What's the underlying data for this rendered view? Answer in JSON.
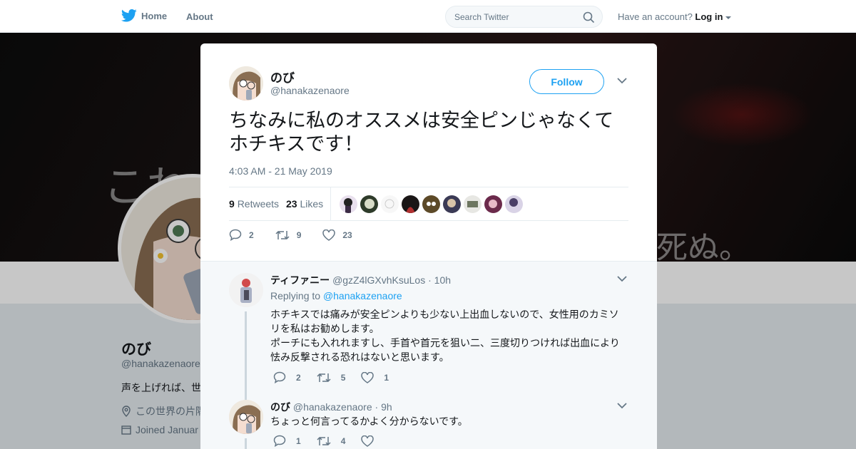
{
  "nav": {
    "home_label": "Home",
    "about_label": "About",
    "search_placeholder": "Search Twitter",
    "account_prompt": "Have an account?",
    "login_label": "Log in"
  },
  "background_profile": {
    "banner_glyphs": [
      "これ",
      "死ぬ。"
    ],
    "name": "のび",
    "handle": "@hanakazenaore",
    "bio": "声を上げれば、世",
    "location": "この世界の片隅",
    "joined": "Joined Januar"
  },
  "tweet": {
    "author_name": "のび",
    "author_handle": "@hanakazenaore",
    "follow_label": "Follow",
    "text": "ちなみに私のオススメは安全ピンじゃなくてホチキスです！",
    "timestamp": "4:03 AM - 21 May 2019",
    "retweets_count": "9",
    "retweets_label": "Retweets",
    "likes_count": "23",
    "likes_label": "Likes",
    "actions": {
      "replies": "2",
      "retweets": "9",
      "likes": "23"
    }
  },
  "replies": [
    {
      "name": "ティファニー",
      "handle": "@gzZ4lGXvhKsuLos",
      "time": "· 10h",
      "replying_prefix": "Replying to",
      "replying_to": "@hanakazenaore",
      "lines": [
        "ホチキスでは痛みが安全ピンよりも少ない上出血しないので、女性用のカミソリを私はお勧めします。",
        "ポーチにも入れれますし、手首や首元を狙い二、三度切りつければ出血により怯み反撃される恐れはないと思います。"
      ],
      "actions": {
        "replies": "2",
        "retweets": "5",
        "likes": "1"
      }
    },
    {
      "name": "のび",
      "handle": "@hanakazenaore",
      "time": "· 9h",
      "lines": [
        "ちょっと何言ってるかよく分からないです。"
      ],
      "actions": {
        "replies": "1",
        "retweets": "4",
        "likes": ""
      }
    }
  ],
  "colors": {
    "accent": "#1da1f2",
    "text_primary": "#14171a",
    "text_secondary": "#657786",
    "page_background": "#e6ecf0"
  }
}
